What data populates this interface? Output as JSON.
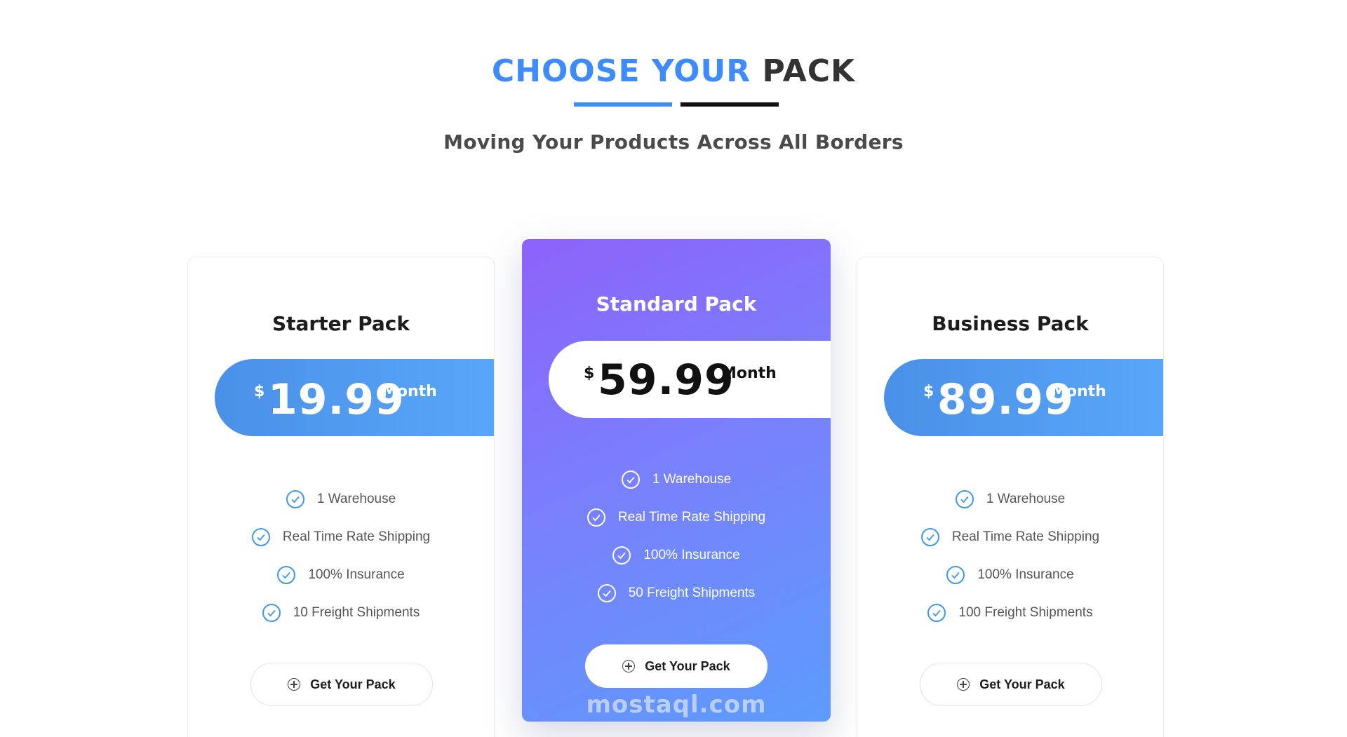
{
  "header": {
    "title_accent": "CHOOSE YOUR",
    "title_rest": "PACK",
    "subtitle": "Moving Your Products Across All Borders"
  },
  "colors": {
    "accent": "#3d8bfd",
    "pill_blue": "#58a8fb",
    "featured_gradient_start": "#8d62fb",
    "featured_gradient_end": "#5c9cfc"
  },
  "plans": [
    {
      "name": "Starter Pack",
      "currency": "$",
      "price": "19.99",
      "period": "Month",
      "features": [
        "1 Warehouse",
        "Real Time Rate Shipping",
        "100% Insurance",
        "10 Freight Shipments"
      ],
      "cta": "Get Your Pack",
      "featured": false
    },
    {
      "name": "Standard Pack",
      "currency": "$",
      "price": "59.99",
      "period": "Month",
      "features": [
        "1 Warehouse",
        "Real Time Rate Shipping",
        "100% Insurance",
        "50 Freight Shipments"
      ],
      "cta": "Get Your Pack",
      "featured": true
    },
    {
      "name": "Business Pack",
      "currency": "$",
      "price": "89.99",
      "period": "Month",
      "features": [
        "1 Warehouse",
        "Real Time Rate Shipping",
        "100% Insurance",
        "100 Freight Shipments"
      ],
      "cta": "Get Your Pack",
      "featured": false
    }
  ],
  "icons": {
    "feature": "check-circle-icon",
    "cta": "plus-circle-icon"
  },
  "watermark": "mostaql.com"
}
